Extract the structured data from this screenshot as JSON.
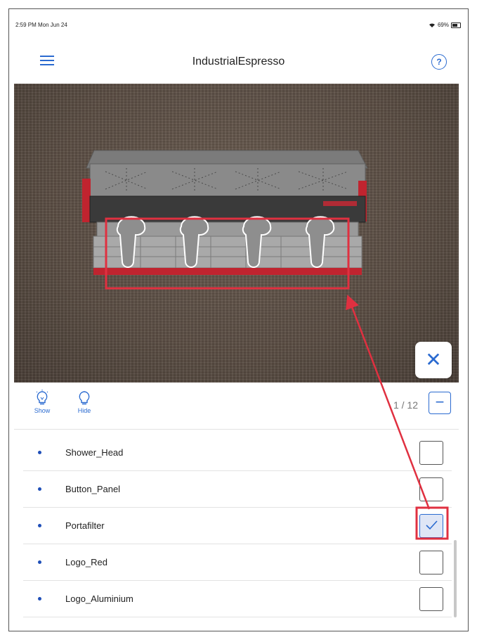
{
  "status_bar": {
    "time": "2:59 PM  Mon Jun 24",
    "battery": "69%"
  },
  "header": {
    "title": "IndustrialEspresso",
    "help_icon": "?"
  },
  "viewer": {
    "close_symbol": "✕"
  },
  "toolbar": {
    "show_label": "Show",
    "hide_label": "Hide",
    "counter_current": "1",
    "counter_text": "/ 12",
    "minus_symbol": "−"
  },
  "parts": [
    {
      "label": "Shower_Head",
      "checked": false
    },
    {
      "label": "Button_Panel",
      "checked": false
    },
    {
      "label": "Portafilter",
      "checked": true
    },
    {
      "label": "Logo_Red",
      "checked": false
    },
    {
      "label": "Logo_Aluminium",
      "checked": false
    }
  ],
  "colors": {
    "accent": "#2a6ad0",
    "annotation": "#e03040"
  }
}
